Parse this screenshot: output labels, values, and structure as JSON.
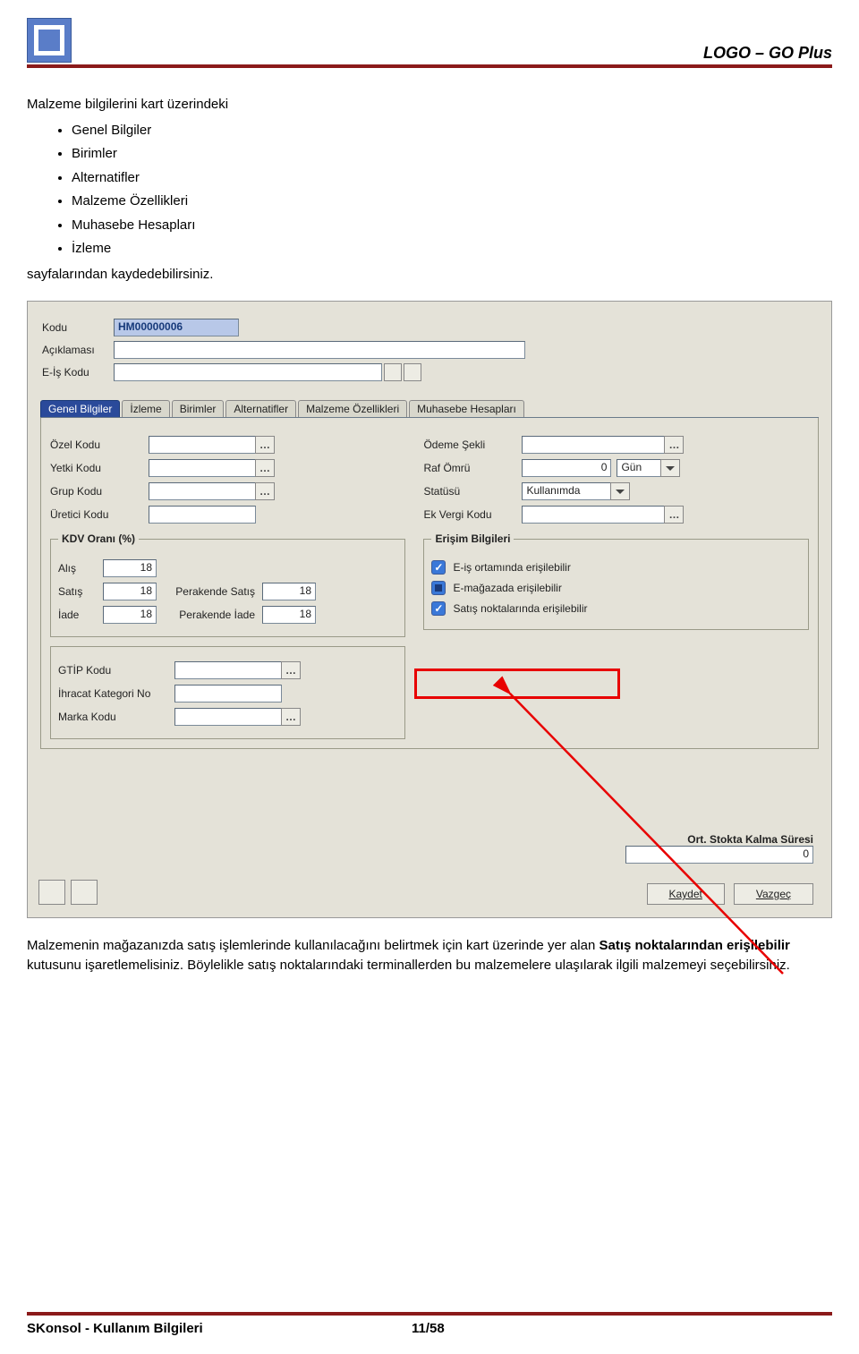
{
  "header": {
    "product": "LOGO – GO Plus"
  },
  "intro": {
    "lead": "Malzeme bilgilerini kart üzerindeki",
    "items": [
      "Genel Bilgiler",
      "Birimler",
      "Alternatifler",
      "Malzeme Özellikleri",
      "Muhasebe Hesapları",
      "İzleme"
    ],
    "tail": "sayfalarından kaydedebilirsiniz."
  },
  "form": {
    "top": {
      "kodu_label": "Kodu",
      "kodu_value": "HM00000006",
      "aciklama_label": "Açıklaması",
      "aciklama_value": "",
      "eis_label": "E-İş Kodu",
      "eis_value": ""
    },
    "tabs": [
      "Genel Bilgiler",
      "İzleme",
      "Birimler",
      "Alternatifler",
      "Malzeme Özellikleri",
      "Muhasebe Hesapları"
    ],
    "left": {
      "ozel_label": "Özel Kodu",
      "yetki_label": "Yetki Kodu",
      "grup_label": "Grup Kodu",
      "uretici_label": "Üretici Kodu"
    },
    "right": {
      "odeme_label": "Ödeme Şekli",
      "raf_label": "Raf Ömrü",
      "raf_value": "0",
      "raf_unit": "Gün",
      "statu_label": "Statüsü",
      "statu_value": "Kullanımda",
      "ekvergi_label": "Ek Vergi Kodu"
    },
    "kdv": {
      "legend": "KDV Oranı (%)",
      "alis_label": "Alış",
      "alis_value": "18",
      "satis_label": "Satış",
      "satis_value": "18",
      "iade_label": "İade",
      "iade_value": "18",
      "per_satis_label": "Perakende Satış",
      "per_satis_value": "18",
      "per_iade_label": "Perakende İade",
      "per_iade_value": "18"
    },
    "erisim": {
      "legend": "Erişim Bilgileri",
      "c1": "E-iş ortamında erişilebilir",
      "c2": "E-mağazada erişilebilir",
      "c3": "Satış noktalarında erişilebilir"
    },
    "gtip": {
      "gtip_label": "GTİP Kodu",
      "ihracat_label": "İhracat Kategori No",
      "marka_label": "Marka Kodu"
    },
    "ort": {
      "title": "Ort. Stokta Kalma Süresi",
      "value": "0"
    },
    "buttons": {
      "save": "Kaydet",
      "cancel": "Vazgeç"
    }
  },
  "after": {
    "p1a": "Malzemenin mağazanızda satış işlemlerinde kullanılacağını belirtmek için kart üzerinde yer alan ",
    "p1b": "Satış noktalarından erişilebilir",
    "p1c": " kutusunu işaretlemelisiniz.  Böylelikle satış noktalarındaki terminallerden  bu malzemelere ulaşılarak ilgili malzemeyi seçebilirsiniz."
  },
  "footer": {
    "left": "SKonsol - Kullanım Bilgileri",
    "page": "11/58"
  }
}
